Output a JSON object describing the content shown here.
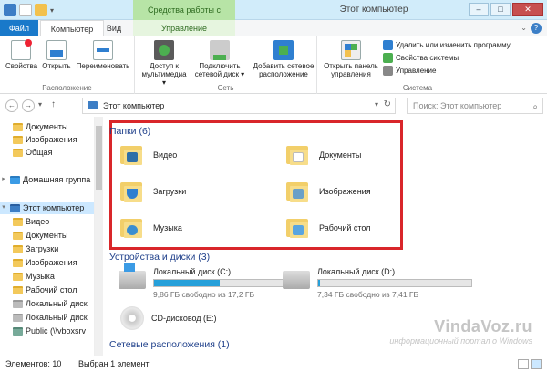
{
  "window": {
    "title": "Этот компьютер",
    "context_tab_header": "Средства работы с дисками",
    "minimize": "–",
    "maximize": "□",
    "close": "✕"
  },
  "tabs": {
    "file": "Файл",
    "computer": "Компьютер",
    "view": "Вид",
    "manage": "Управление",
    "help": "?"
  },
  "ribbon": {
    "location": {
      "label": "Расположение",
      "properties": "Свойства",
      "open": "Открыть",
      "rename": "Переименовать"
    },
    "network": {
      "label": "Сеть",
      "media_access": [
        "Доступ к",
        "мультимедиа ▾"
      ],
      "map_drive": [
        "Подключить",
        "сетевой диск ▾"
      ],
      "add_location": [
        "Добавить сетевое",
        "расположение"
      ]
    },
    "system": {
      "label": "Система",
      "control_panel": [
        "Открыть панель",
        "управления"
      ],
      "uninstall": "Удалить или изменить программу",
      "sys_props": "Свойства системы",
      "manage": "Управление"
    },
    "colors": {
      "blue": "#2f7fd0",
      "green": "#4caf50",
      "yellow": "#f2c14e"
    }
  },
  "nav": {
    "back": "←",
    "forward": "→",
    "dropdown": "▾",
    "up": "↑",
    "address": "Этот компьютер",
    "addr_dropdown": "▾",
    "refresh": "↻",
    "search_placeholder": "Поиск: Этот компьютер",
    "search_glyph": "⌕"
  },
  "navpane": {
    "items": [
      "Документы",
      "Изображения",
      "Общая",
      "Домашняя группа",
      "Этот компьютер",
      "Видео",
      "Документы",
      "Загрузки",
      "Изображения",
      "Музыка",
      "Рабочий стол",
      "Локальный диск",
      "Локальный диск",
      "Public (\\\\vboxsrv"
    ]
  },
  "content": {
    "folders_header": "Папки (6)",
    "folders": [
      "Видео",
      "Документы",
      "Загрузки",
      "Изображения",
      "Музыка",
      "Рабочий стол"
    ],
    "devices_header": "Устройства и диски (3)",
    "drives": [
      {
        "name": "Локальный диск (C:)",
        "free": "9,86 ГБ свободно из 17,2 ГБ",
        "used_fraction": 0.43
      },
      {
        "name": "Локальный диск (D:)",
        "free": "7,34 ГБ свободно из 7,41 ГБ",
        "used_fraction": 0.01
      }
    ],
    "cd_drive": "CD-дисковод (E:)",
    "network_header": "Сетевые расположения (1)"
  },
  "status": {
    "items": "Элементов: 10",
    "selected": "Выбран 1 элемент"
  },
  "watermark": {
    "site": "VindaVoz.ru",
    "tagline": "информационный портал о Windows"
  }
}
